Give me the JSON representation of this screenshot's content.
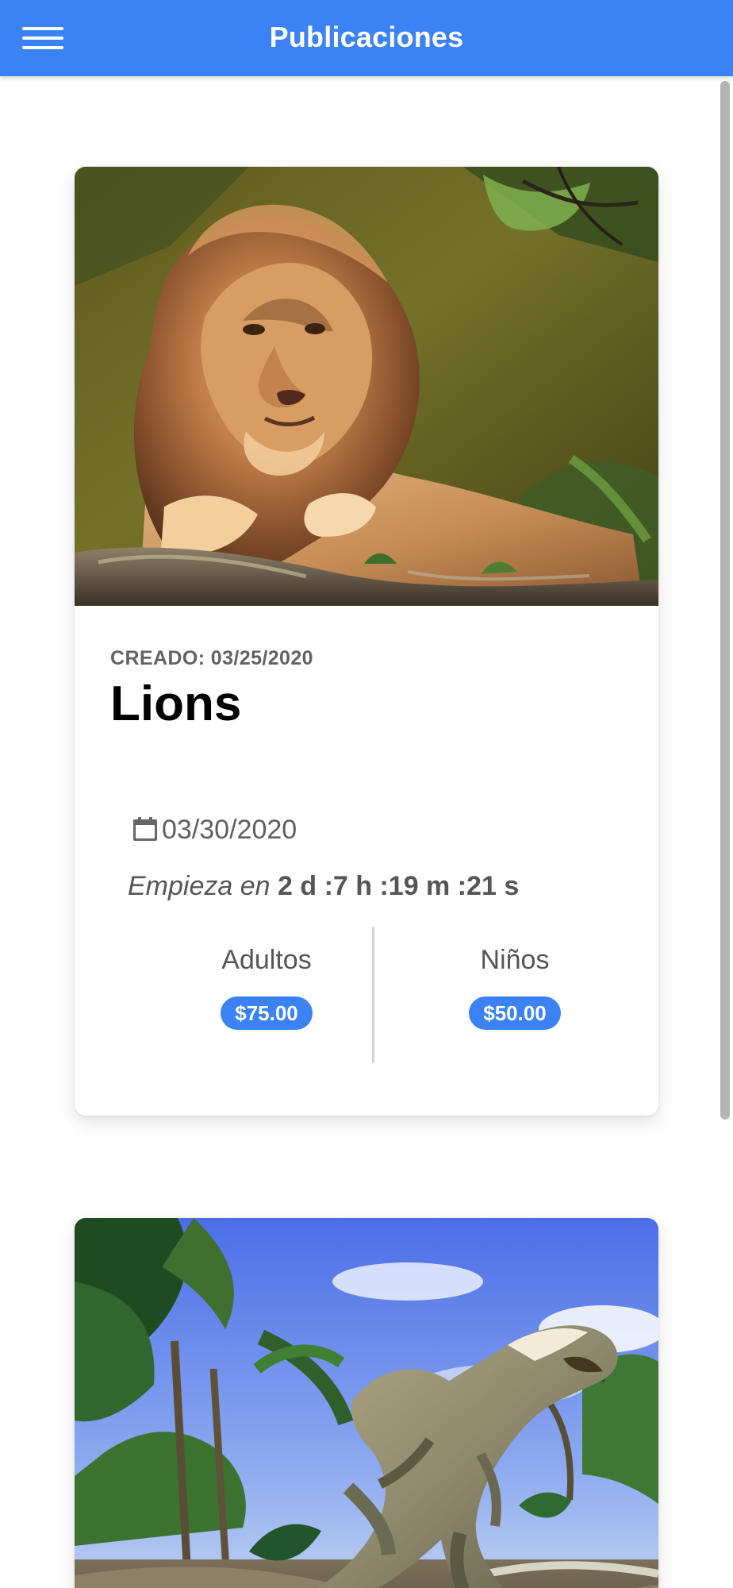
{
  "header": {
    "title": "Publicaciones",
    "menu_icon": "hamburger-menu-icon"
  },
  "theme": {
    "primary": "#3b82f6",
    "text_muted": "#555555",
    "title": "#000000"
  },
  "posts": [
    {
      "created": "CREADO: 03/25/2020",
      "title": "Lions",
      "image_subject": "lion",
      "event_date": "03/30/2020",
      "countdown_prefix": "Empieza en",
      "countdown": "2 d :7 h :19 m :21  s",
      "prices": [
        {
          "label": "Adultos",
          "value": "$75.00"
        },
        {
          "label": "Niños",
          "value": "$50.00"
        }
      ]
    },
    {
      "image_subject": "tyrannosaurus"
    }
  ]
}
